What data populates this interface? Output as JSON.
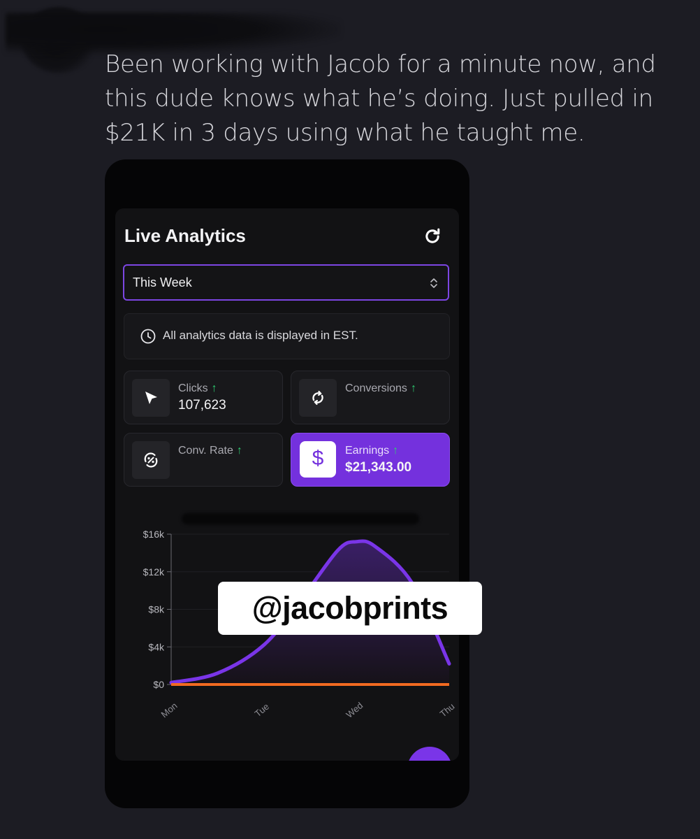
{
  "post": {
    "text": "Been working with Jacob for a minute now, and this dude knows what he’s doing. Just pulled in $21K in 3 days using what he taught me."
  },
  "app": {
    "title": "Live Analytics",
    "period_select": {
      "selected": "This Week"
    },
    "notice": "All analytics data is displayed in EST.",
    "stats": [
      {
        "label": "Clicks",
        "value": "107,623",
        "trend": "up",
        "icon": "cursor-icon"
      },
      {
        "label": "Conversions",
        "value": "",
        "trend": "up",
        "icon": "sync-icon"
      },
      {
        "label": "Conv. Rate",
        "value": "",
        "trend": "up",
        "icon": "percent-icon"
      },
      {
        "label": "Earnings",
        "value": "$21,343.00",
        "trend": "up",
        "icon": "dollar-icon",
        "active": true
      }
    ],
    "trend_arrow": "↑",
    "dollar_symbol": "$"
  },
  "watermark": {
    "text": "@jacobprints"
  },
  "colors": {
    "background": "#1c1c23",
    "accent": "#7431dd",
    "trend_up": "#2ecc71",
    "orange_series": "#f26a21"
  },
  "chart_data": {
    "type": "area",
    "categories": [
      "Mon",
      "Tue",
      "Wed",
      "Thu"
    ],
    "ylim": [
      0,
      16000
    ],
    "y_ticks": [
      "$0",
      "$4k",
      "$8k",
      "$12k",
      "$16k"
    ],
    "y_tick_values": [
      0,
      4000,
      8000,
      12000,
      16000
    ],
    "series": [
      {
        "color": "#7a35e8",
        "points": [
          [
            0,
            200
          ],
          [
            0.5,
            1200
          ],
          [
            1,
            4200
          ],
          [
            1.4,
            9000
          ],
          [
            1.8,
            14300
          ],
          [
            2.0,
            15200
          ],
          [
            2.2,
            14700
          ],
          [
            2.6,
            10800
          ],
          [
            3,
            2200
          ]
        ]
      },
      {
        "color": "#f26a21",
        "points": [
          [
            0,
            0
          ],
          [
            1,
            0
          ],
          [
            2,
            0
          ],
          [
            3,
            0
          ]
        ]
      }
    ],
    "grid": true
  }
}
